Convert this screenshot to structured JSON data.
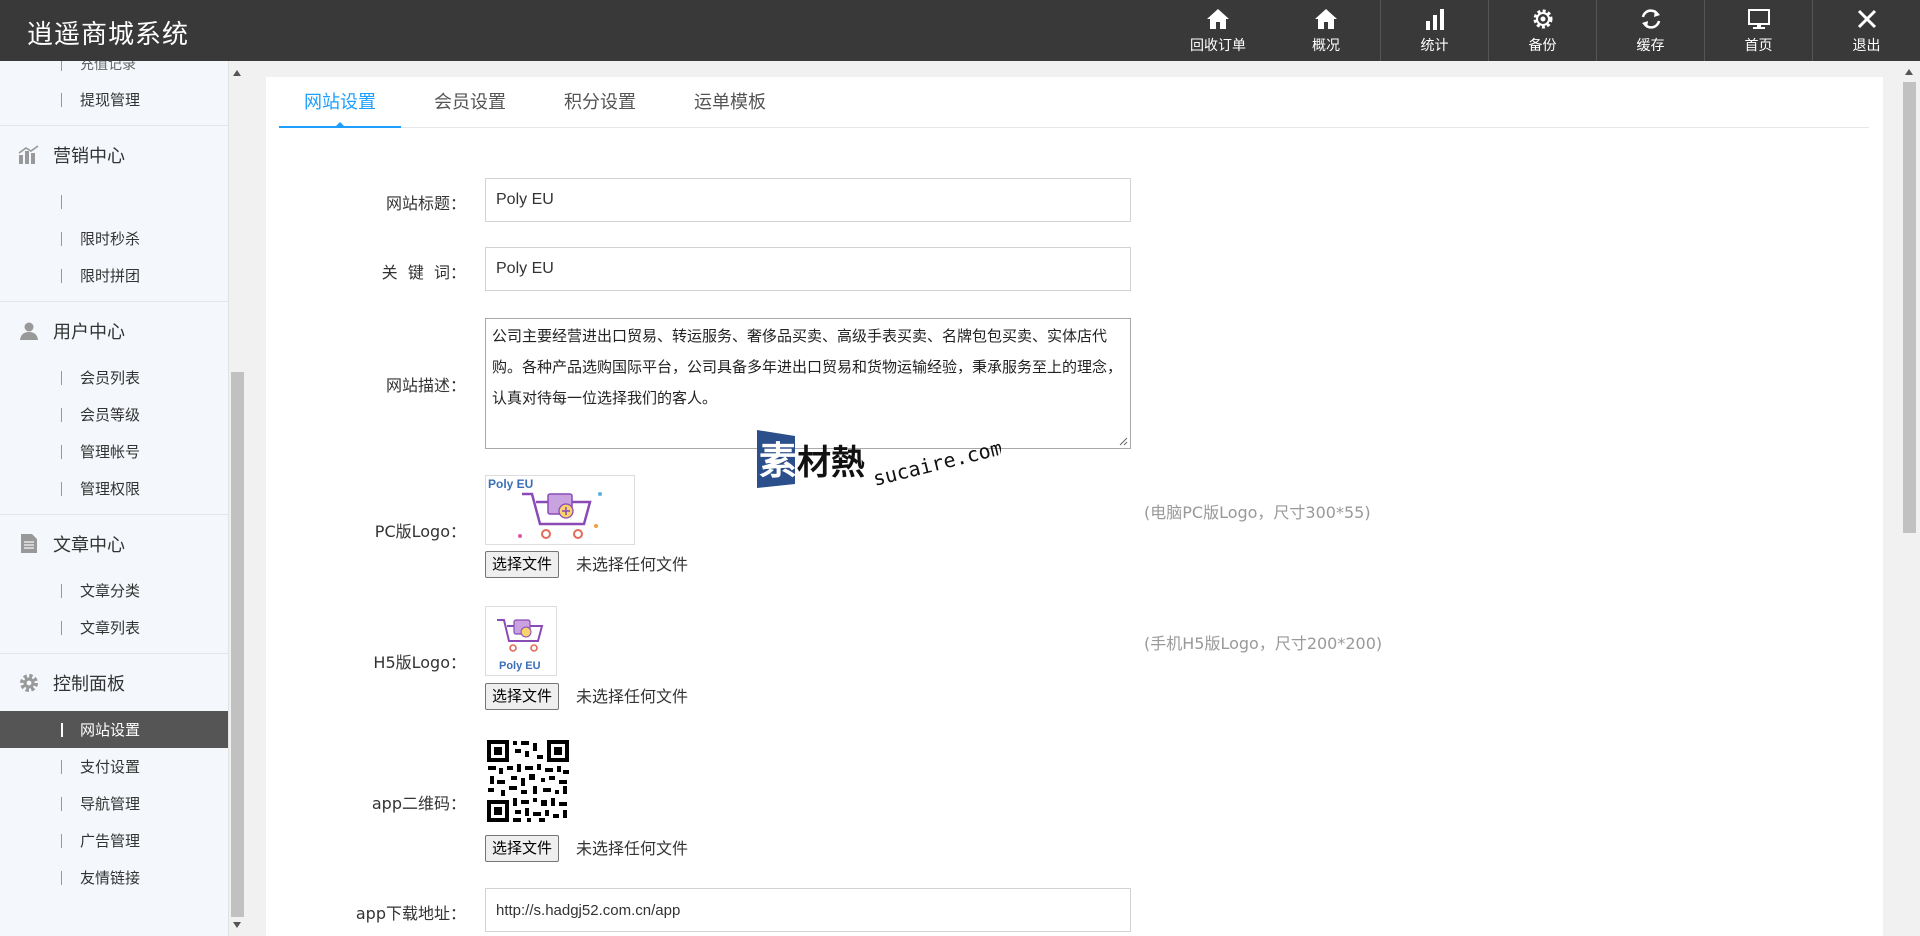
{
  "app": {
    "brand": "逍遥商城系统"
  },
  "topnav": [
    {
      "label": "回收订单",
      "icon": "home-icon"
    },
    {
      "label": "概况",
      "icon": "home-icon"
    },
    {
      "label": "统计",
      "icon": "bar-chart-icon"
    },
    {
      "label": "备份",
      "icon": "gear-icon"
    },
    {
      "label": "缓存",
      "icon": "refresh-icon"
    },
    {
      "label": "首页",
      "icon": "monitor-icon"
    },
    {
      "label": "退出",
      "icon": "close-icon"
    }
  ],
  "sidebar": {
    "cut_item": "充值记录",
    "finance_items": [
      "提现管理"
    ],
    "groups": [
      {
        "title": "营销中心",
        "icon": "chart-icon",
        "items": [
          "",
          "限时秒杀",
          "限时拼团"
        ]
      },
      {
        "title": "用户中心",
        "icon": "user-icon",
        "items": [
          "会员列表",
          "会员等级",
          "管理帐号",
          "管理权限"
        ]
      },
      {
        "title": "文章中心",
        "icon": "document-icon",
        "items": [
          "文章分类",
          "文章列表"
        ]
      },
      {
        "title": "控制面板",
        "icon": "gear-icon",
        "items": [
          "网站设置",
          "支付设置",
          "导航管理",
          "广告管理",
          "友情链接"
        ],
        "active": "网站设置"
      }
    ]
  },
  "tabs": [
    "网站设置",
    "会员设置",
    "积分设置",
    "运单模板"
  ],
  "form": {
    "site_title": {
      "label": "网站标题：",
      "value": "Poly EU"
    },
    "keywords": {
      "label": "关  键  词：",
      "value": "Poly EU"
    },
    "description": {
      "label": "网站描述：",
      "value": "公司主要经营进出口贸易、转运服务、奢侈品买卖、高级手表买卖、名牌包包买卖、实体店代购。各种产品选购国际平台，公司具备多年进出口贸易和货物运输经验，秉承服务至上的理念，认真对待每一位选择我们的客人。"
    },
    "pc_logo": {
      "label": "PC版Logo：",
      "hint": "(电脑PC版Logo，尺寸300*55)",
      "logo_text": "Poly EU"
    },
    "h5_logo": {
      "label": "H5版Logo：",
      "hint": "(手机H5版Logo，尺寸200*200)",
      "logo_text": "Poly EU"
    },
    "app_qr": {
      "label": "app二维码："
    },
    "app_url": {
      "label": "app下载地址：",
      "value": "http://s.hadgj52.com.cn/app"
    },
    "file_button": "选择文件",
    "file_none": "未选择任何文件"
  },
  "watermark": {
    "cn": "素材熱",
    "en": "sucaire.com"
  },
  "colors": {
    "header": "#393939",
    "accent": "#1e9fff",
    "sidebar_active": "#555555"
  }
}
